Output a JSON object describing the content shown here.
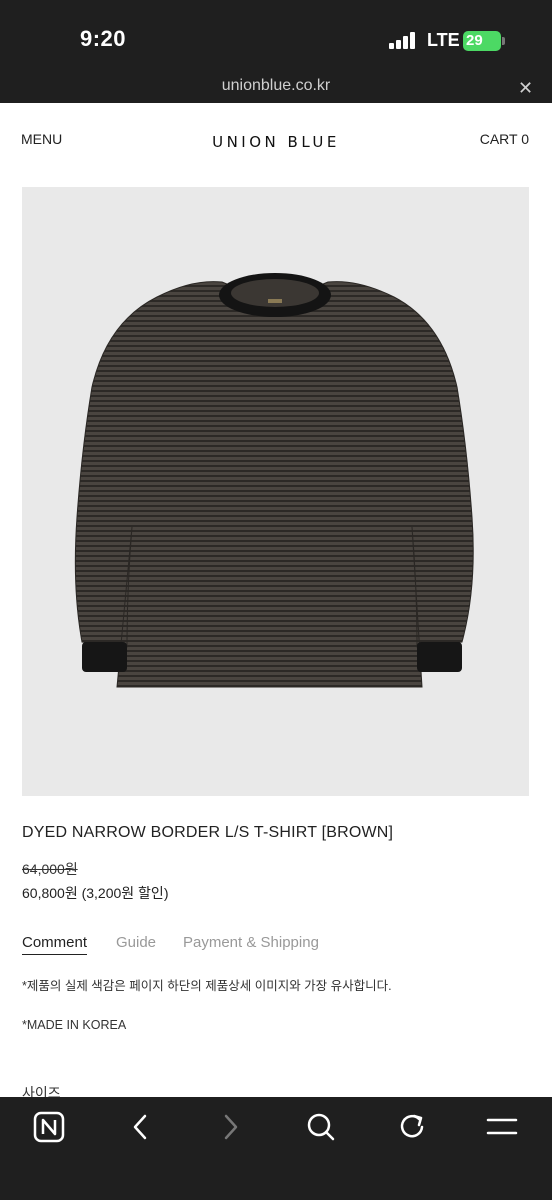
{
  "status_bar": {
    "time": "9:20",
    "network": "LTE",
    "battery": "29",
    "battery_color": "#4cd964"
  },
  "browser": {
    "url": "unionblue.co.kr",
    "close_icon": "close-icon"
  },
  "header": {
    "menu_label": "MENU",
    "logo": "UNION BLUE",
    "cart_label": "CART 0"
  },
  "product": {
    "title": "DYED NARROW BORDER L/S T-SHIRT [BROWN]",
    "original_price": "64,000원",
    "sale_price": "60,800원 (3,200원 할인)"
  },
  "tabs": [
    {
      "label": "Comment",
      "active": true
    },
    {
      "label": "Guide",
      "active": false
    },
    {
      "label": "Payment & Shipping",
      "active": false
    }
  ],
  "details": {
    "note_color": "*제품의 실제 색감은 페이지 하단의 제품상세 이미지와 가장 유사합니다.",
    "note_origin": "*MADE IN KOREA",
    "size_label": "사이즈"
  },
  "toolbar": {
    "icons": [
      "naver-logo-icon",
      "back-arrow-icon",
      "forward-arrow-icon",
      "search-icon",
      "refresh-icon",
      "menu-icon"
    ]
  }
}
